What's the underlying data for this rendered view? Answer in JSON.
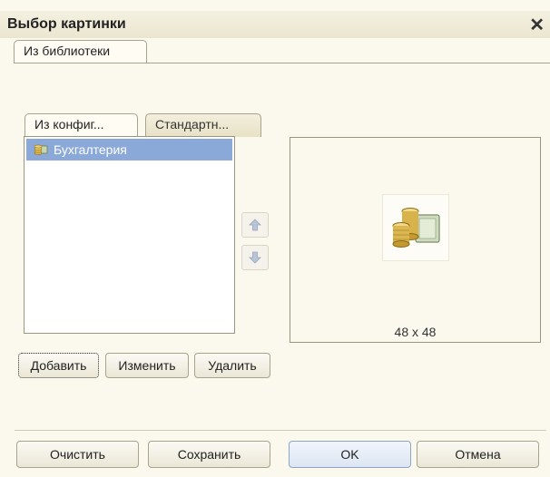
{
  "window": {
    "title": "Выбор картинки",
    "close_glyph": "✕"
  },
  "tabs": {
    "top": [
      "Из библиотеки"
    ],
    "inner": [
      "Из конфиг...",
      "Стандартн..."
    ]
  },
  "list": {
    "items": [
      {
        "label": "Бухгалтерия",
        "icon": "coins-icon",
        "selected": true
      }
    ]
  },
  "preview": {
    "size_label": "48 x 48",
    "icon": "coins-icon"
  },
  "list_buttons": {
    "add": "Добавить",
    "edit": "Изменить",
    "delete": "Удалить"
  },
  "footer_buttons": {
    "clear": "Очистить",
    "save": "Сохранить",
    "ok": "OK",
    "cancel": "Отмена"
  },
  "colors": {
    "selection": "#8aa9d8",
    "dialog_bg": "#fbf9ee"
  }
}
